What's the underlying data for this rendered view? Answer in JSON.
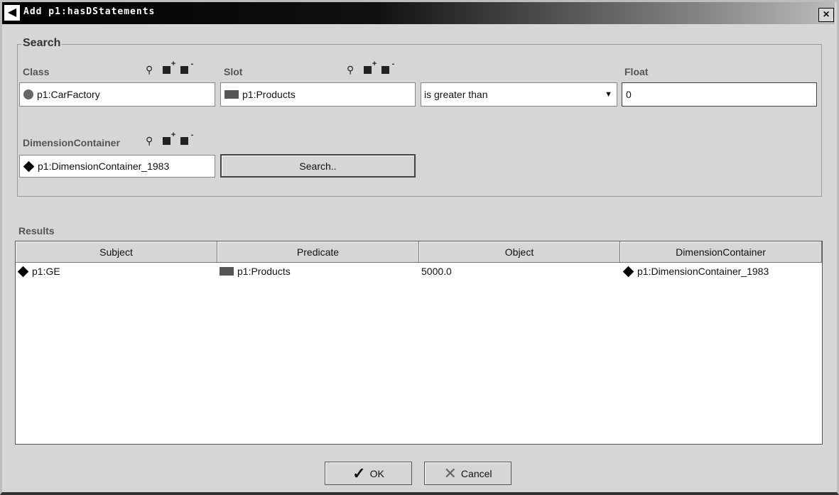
{
  "window": {
    "title": "Add p1:hasDStatements",
    "close": "×"
  },
  "search": {
    "legend": "Search",
    "class": {
      "label": "Class",
      "value": "p1:CarFactory"
    },
    "slot": {
      "label": "Slot",
      "value": "p1:Products"
    },
    "operator": {
      "value": "is greater than"
    },
    "float": {
      "label": "Float",
      "value": "0"
    },
    "dimension": {
      "label": "DimensionContainer",
      "value": "p1:DimensionContainer_1983"
    },
    "search_button": "Search.."
  },
  "results": {
    "label": "Results",
    "columns": [
      "Subject",
      "Predicate",
      "Object",
      "DimensionContainer"
    ],
    "rows": [
      [
        "p1:GE",
        "p1:Products",
        "5000.0",
        "p1:DimensionContainer_1983"
      ]
    ]
  },
  "buttons": {
    "ok": "OK",
    "cancel": "Cancel"
  }
}
